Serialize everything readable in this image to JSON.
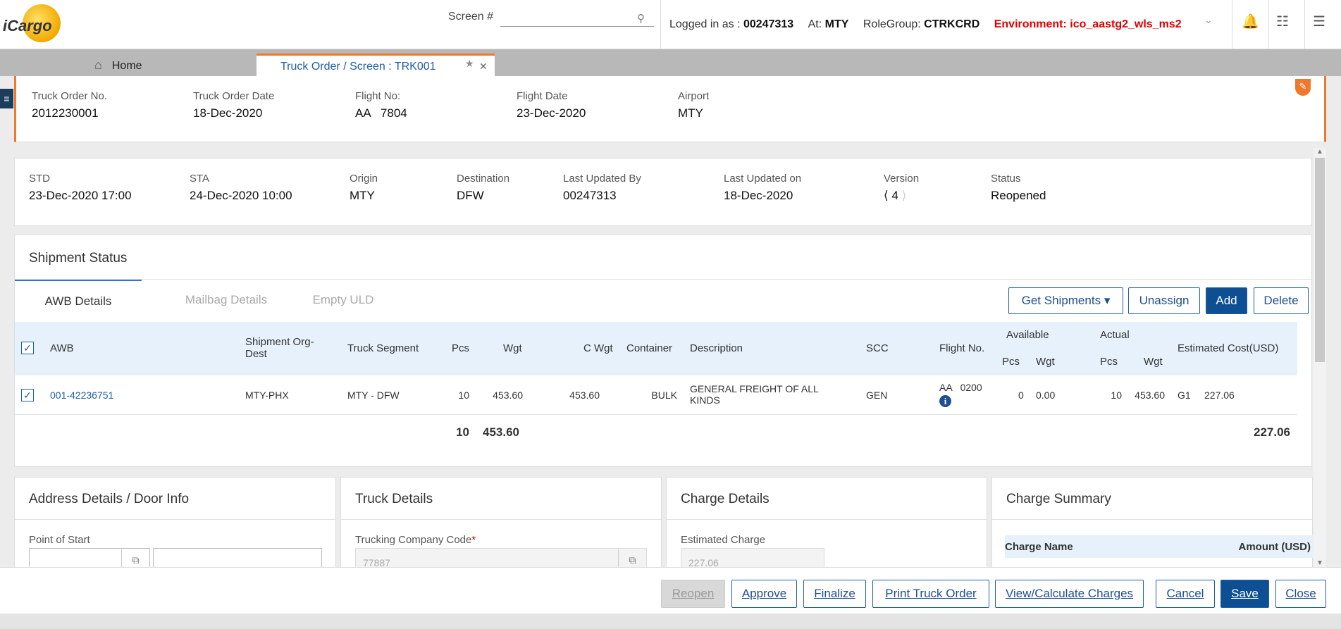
{
  "app": {
    "logo_text": "iCargo"
  },
  "topbar": {
    "screen_label": "Screen #",
    "screen_value": "",
    "logged_in_label": "Logged in as :",
    "user_id": "00247313",
    "at_label": "At:",
    "station": "MTY",
    "rolegroup_label": "RoleGroup:",
    "rolegroup": "CTRKCRD",
    "environment": "Environment: ico_aastg2_wls_ms2"
  },
  "tabs": {
    "home": "Home",
    "active": "Truck Order / Screen : TRK001"
  },
  "header": {
    "truck_order_no": {
      "label": "Truck Order No.",
      "value": "2012230001"
    },
    "truck_order_date": {
      "label": "Truck Order Date",
      "value": "18-Dec-2020"
    },
    "flight_no": {
      "label": "Flight No:",
      "value": "AA   7804"
    },
    "flight_date": {
      "label": "Flight Date",
      "value": "23-Dec-2020"
    },
    "airport": {
      "label": "Airport",
      "value": "MTY"
    }
  },
  "info": {
    "std": {
      "label": "STD",
      "value": "23-Dec-2020 17:00"
    },
    "sta": {
      "label": "STA",
      "value": "24-Dec-2020 10:00"
    },
    "origin": {
      "label": "Origin",
      "value": "MTY"
    },
    "destination": {
      "label": "Destination",
      "value": "DFW"
    },
    "last_updated_by": {
      "label": "Last Updated By",
      "value": "00247313"
    },
    "last_updated_on": {
      "label": "Last Updated on",
      "value": "18-Dec-2020"
    },
    "version": {
      "label": "Version",
      "value": "4"
    },
    "status": {
      "label": "Status",
      "value": "Reopened"
    }
  },
  "shipment": {
    "title": "Shipment Status",
    "tabs": [
      "AWB Details",
      "Mailbag Details",
      "Empty ULD"
    ],
    "buttons": {
      "get_shipments": "Get Shipments",
      "unassign": "Unassign",
      "add": "Add",
      "delete": "Delete"
    },
    "columns": {
      "awb": "AWB",
      "org_dest": "Shipment Org-Dest",
      "truck_segment": "Truck Segment",
      "pcs": "Pcs",
      "wgt": "Wgt",
      "c_wgt": "C Wgt",
      "container": "Container",
      "description": "Description",
      "scc": "SCC",
      "flight_no": "Flight No.",
      "available": "Available",
      "actual": "Actual",
      "sub_pcs": "Pcs",
      "sub_wgt": "Wgt",
      "estimated_cost": "Estimated Cost(USD)"
    },
    "rows": [
      {
        "awb": "001-42236751",
        "org_dest": "MTY-PHX",
        "truck_segment": "MTY - DFW",
        "pcs": "10",
        "wgt": "453.60",
        "c_wgt": "453.60",
        "container": "BULK",
        "description": "GENERAL FREIGHT OF ALL KINDS",
        "scc": "GEN",
        "flight_no": "AA   0200",
        "avail_pcs": "0",
        "avail_wgt": "0.00",
        "actual_pcs": "10",
        "actual_wgt": "453.60",
        "cost_code": "G1",
        "cost": "227.06"
      }
    ],
    "totals": {
      "pcs": "10",
      "wgt": "453.60",
      "cost": "227.06"
    }
  },
  "cards": {
    "address": {
      "title": "Address Details / Door Info",
      "field_label": "Point of Start"
    },
    "truck": {
      "title": "Truck Details",
      "field_label": "Trucking Company Code",
      "field_value": "77887"
    },
    "charge": {
      "title": "Charge Details",
      "field_label": "Estimated Charge",
      "field_value": "227.06"
    },
    "summary": {
      "title": "Charge Summary",
      "col_name": "Charge Name",
      "col_amount": "Amount (USD)"
    }
  },
  "footer": {
    "reopen": "Reopen",
    "approve": "Approve",
    "finalize": "Finalize",
    "print": "Print Truck Order",
    "view_calc": "View/Calculate Charges",
    "cancel": "Cancel",
    "save": "Save",
    "close": "Close"
  },
  "colors": {
    "accent": "#f0782d",
    "primary": "#0d4f92",
    "link": "#1f5fa8",
    "env": "#e00000"
  }
}
